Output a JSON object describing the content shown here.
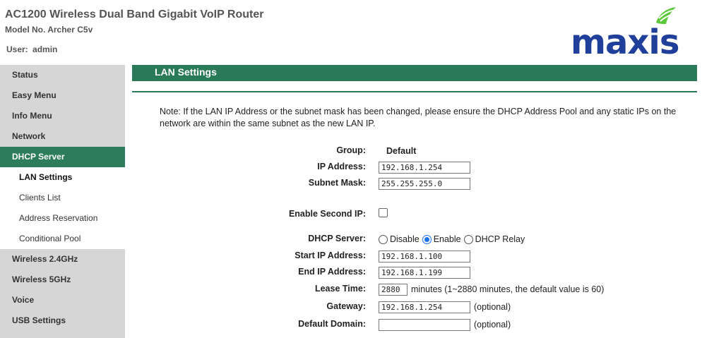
{
  "header": {
    "title": "AC1200 Wireless Dual Band Gigabit VoIP Router",
    "model": "Model No. Archer C5v",
    "user_label": "User:",
    "user_name": "admin",
    "logo_text": "maxis",
    "logo_color": "#1f3f9a",
    "logo_accent": "#5cc83b"
  },
  "sidebar": {
    "items": [
      {
        "label": "Status"
      },
      {
        "label": "Easy Menu"
      },
      {
        "label": "Info Menu"
      },
      {
        "label": "Network"
      },
      {
        "label": "DHCP Server"
      },
      {
        "label": "Wireless 2.4GHz"
      },
      {
        "label": "Wireless 5GHz"
      },
      {
        "label": "Voice"
      },
      {
        "label": "USB Settings"
      }
    ],
    "sub_items": [
      {
        "label": "LAN Settings"
      },
      {
        "label": "Clients List"
      },
      {
        "label": "Address Reservation"
      },
      {
        "label": "Conditional Pool"
      }
    ]
  },
  "main": {
    "section_title": "LAN Settings",
    "note": "Note: If the LAN IP Address or the subnet mask has been changed, please ensure the DHCP Address Pool and any static IPs on the network are within the same subnet as the new LAN IP.",
    "form": {
      "group_label": "Group:",
      "group_value": "Default",
      "ip_label": "IP Address:",
      "ip_value": "192.168.1.254",
      "mask_label": "Subnet Mask:",
      "mask_value": "255.255.255.0",
      "second_ip_label": "Enable Second IP:",
      "dhcp_label": "DHCP Server:",
      "dhcp_options": [
        "Disable",
        "Enable",
        "DHCP Relay"
      ],
      "dhcp_selected": "Enable",
      "start_label": "Start IP Address:",
      "start_value": "192.168.1.100",
      "end_label": "End IP Address:",
      "end_value": "192.168.1.199",
      "lease_label": "Lease Time:",
      "lease_value": "2880",
      "lease_hint": "minutes (1~2880 minutes, the default value is 60)",
      "gateway_label": "Gateway:",
      "gateway_value": "192.168.1.254",
      "optional": "(optional)",
      "domain_label": "Default Domain:",
      "domain_value": ""
    }
  }
}
